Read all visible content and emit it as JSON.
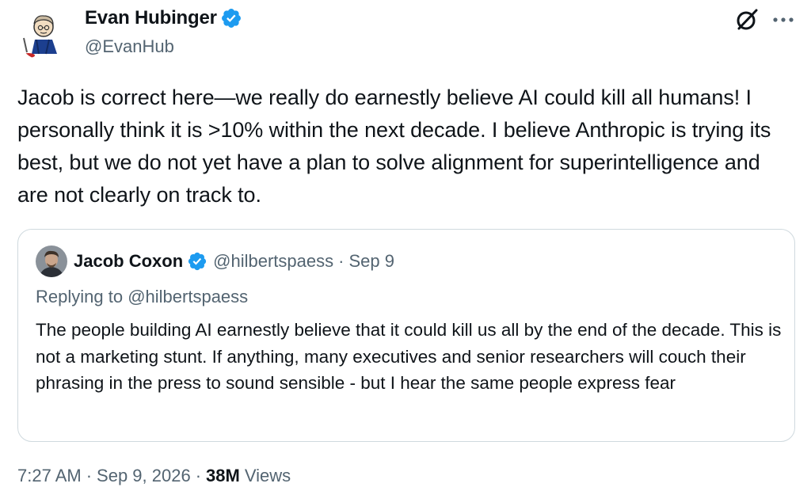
{
  "tweet": {
    "author": {
      "display_name": "Evan Hubinger",
      "handle": "@EvanHub",
      "verified": true,
      "avatar_icon": "cartoon-avatar"
    },
    "text": "Jacob is correct here—we really do earnestly believe AI could kill all humans! I personally think it is >10% within the next decade. I believe Anthropic is trying its best, but we do not yet have a plan to solve alignment for superintelligence and are not clearly on track to.",
    "top_actions": {
      "grok_icon": "grok-icon",
      "more_icon": "more-horizontal-icon"
    },
    "footer": {
      "time": "7:27 AM",
      "separator": "·",
      "date": "Sep 9, 2026",
      "views_count": "38M",
      "views_label": "Views"
    }
  },
  "quote": {
    "author": {
      "display_name": "Jacob Coxon",
      "handle": "@hilbertspaess",
      "verified": true,
      "avatar_icon": "photo-avatar"
    },
    "separator": "·",
    "date": "Sep 9",
    "replying_prefix": "Replying to",
    "replying_to": "@hilbertspaess",
    "text": "The people building AI earnestly believe that it could kill us all by the end of the decade. This is not a marketing stunt. If anything, many executives and senior researchers will couch their phrasing in the press to sound sensible - but I hear the same people express fear"
  },
  "colors": {
    "text_primary": "#0f1419",
    "text_secondary": "#536471",
    "verified_blue": "#1d9bf0",
    "border": "#cfd9de"
  }
}
